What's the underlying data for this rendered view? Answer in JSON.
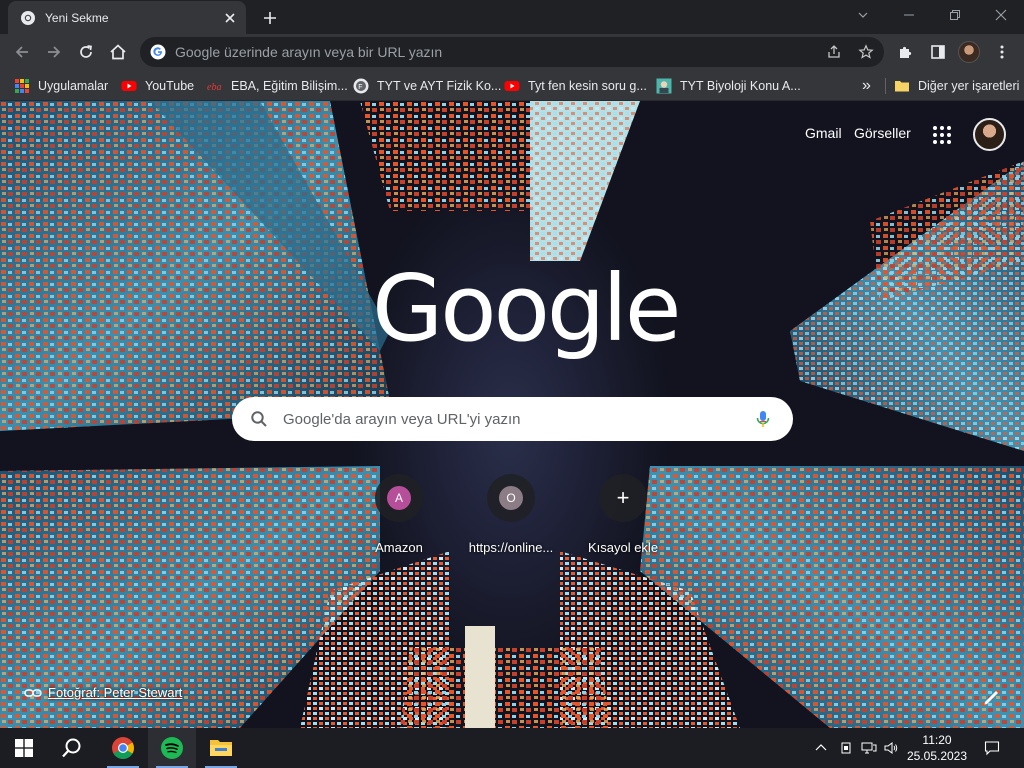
{
  "browser": {
    "tab": {
      "title": "Yeni Sekme"
    },
    "omnibox": {
      "placeholder": "Google üzerinde arayın veya bir URL yazın"
    }
  },
  "bookmarks": {
    "items": [
      {
        "label": "Uygulamalar",
        "icon": "apps-grid-icon"
      },
      {
        "label": "YouTube",
        "icon": "youtube-icon"
      },
      {
        "label": "EBA, Eğitim Bilişim...",
        "icon": "eba-icon"
      },
      {
        "label": "TYT ve AYT Fizik Ko...",
        "icon": "channel-avatar-icon"
      },
      {
        "label": "Tyt fen kesin soru g...",
        "icon": "youtube-icon"
      },
      {
        "label": "TYT Biyoloji Konu A...",
        "icon": "channel-avatar-icon"
      }
    ],
    "overflow": "»",
    "other": {
      "label": "Diğer yer işaretleri",
      "icon": "folder-icon"
    }
  },
  "ntp": {
    "links": {
      "gmail": "Gmail",
      "images": "Görseller"
    },
    "logo": "Google",
    "search_placeholder": "Google'da arayın veya URL'yi yazın",
    "shortcuts": [
      {
        "letter": "A",
        "label": "Amazon",
        "color": "#b64e9a"
      },
      {
        "letter": "O",
        "label": "https://online...",
        "color": "#8c7c86"
      },
      {
        "letter": "+",
        "label": "Kısayol ekle",
        "color": ""
      }
    ],
    "credit": "Fotoğraf: Peter Stewart"
  },
  "taskbar": {
    "apps": [
      "windows-start-icon",
      "search-icon",
      "chrome-icon",
      "spotify-icon",
      "file-explorer-icon"
    ],
    "clock": {
      "time": "11:20",
      "date": "25.05.2023"
    }
  },
  "colors": {
    "tabstrip": "#202124",
    "toolbar": "#35363a",
    "accent_blue": "#8ab4f8",
    "youtube_red": "#ff0000",
    "spotify_green": "#1db954"
  }
}
